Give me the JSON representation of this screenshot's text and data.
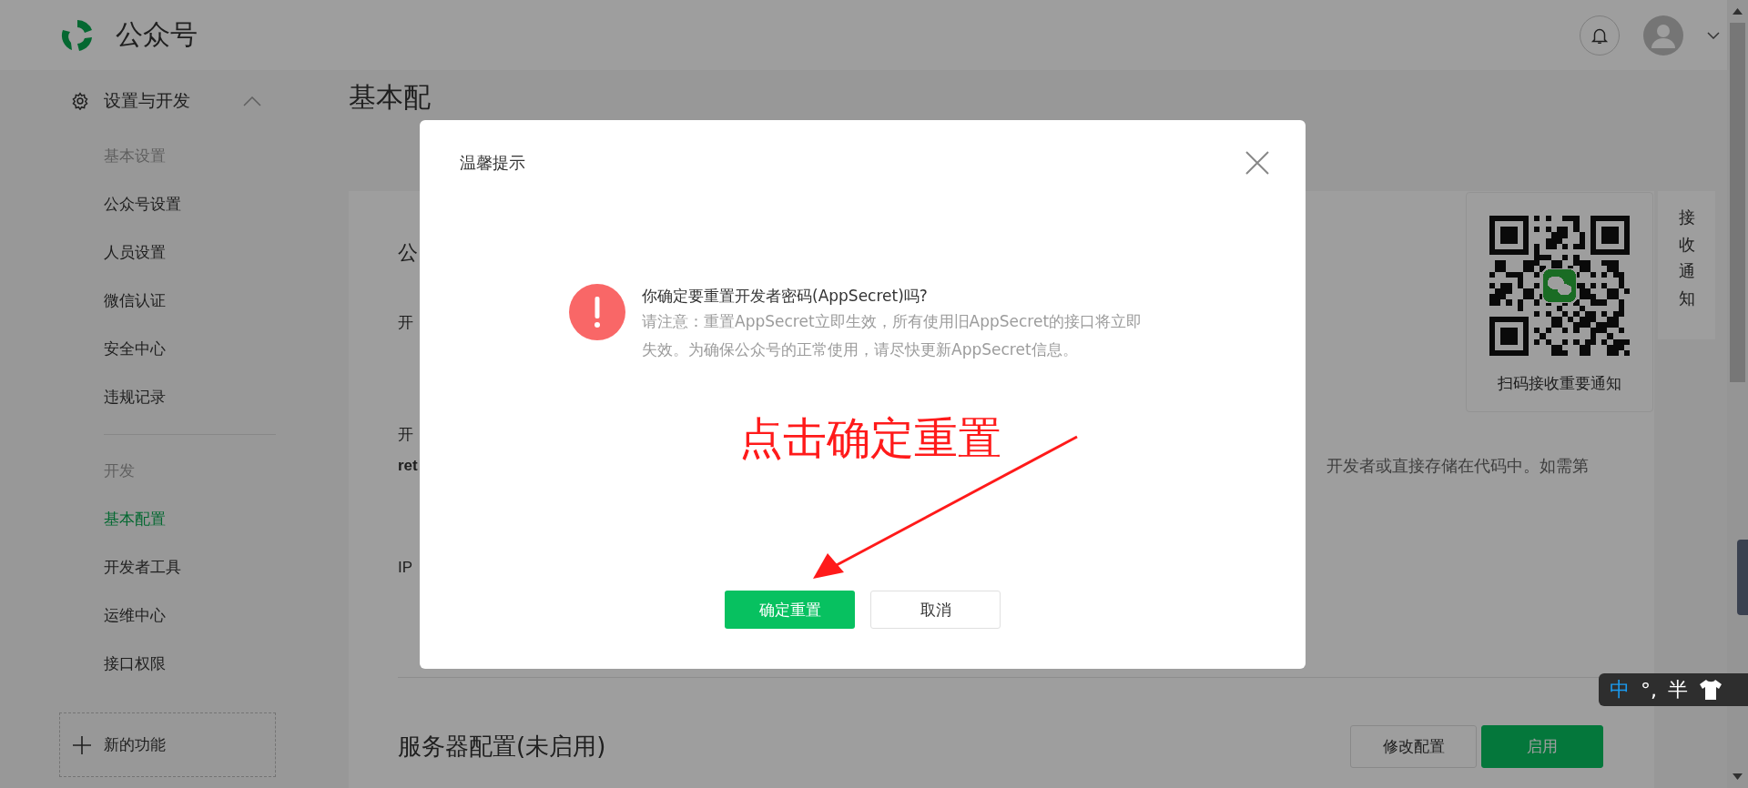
{
  "header": {
    "logo_text": "公众号"
  },
  "sidebar": {
    "section": {
      "label": "设置与开发",
      "expanded": true
    },
    "groups": [
      {
        "label": "基本设置",
        "items": [
          {
            "label": "公众号设置",
            "selected": false
          },
          {
            "label": "人员设置",
            "selected": false
          },
          {
            "label": "微信认证",
            "selected": false
          },
          {
            "label": "安全中心",
            "selected": false
          },
          {
            "label": "违规记录",
            "selected": false
          }
        ]
      },
      {
        "label": "开发",
        "items": [
          {
            "label": "基本配置",
            "selected": true
          },
          {
            "label": "开发者工具",
            "selected": false
          },
          {
            "label": "运维中心",
            "selected": false
          },
          {
            "label": "接口权限",
            "selected": false
          }
        ]
      }
    ],
    "new_feature": "新的功能"
  },
  "page": {
    "title": "基本配",
    "fragments": [
      {
        "text": "公",
        "kind": "heading"
      },
      {
        "text": "开",
        "kind": "label"
      },
      {
        "text": "开",
        "kind": "label"
      },
      {
        "text": "ret",
        "kind": "strong"
      },
      {
        "text": "IP",
        "kind": "label"
      }
    ],
    "right_text": "开发者或直接存储在代码中。如需第",
    "server_section": {
      "title": "服务器配置(未启用)",
      "buttons": [
        {
          "label": "修改配置",
          "kind": "secondary"
        },
        {
          "label": "启用",
          "kind": "primary"
        }
      ]
    }
  },
  "qr_panel": {
    "caption": "扫码接收重要通知"
  },
  "side_tab": {
    "label": "接收通知"
  },
  "dialog": {
    "title": "温馨提示",
    "heading": "你确定要重置开发者密码(AppSecret)吗?",
    "note": "请注意：重置AppSecret立即生效，所有使用旧AppSecret的接口将立即失效。为确保公众号的正常使用，请尽快更新AppSecret信息。",
    "buttons": [
      {
        "label": "确定重置",
        "kind": "primary"
      },
      {
        "label": "取消",
        "kind": "secondary"
      }
    ]
  },
  "annotation": {
    "text": "点击确定重置"
  },
  "ime_toolbar": {
    "items": [
      {
        "text": "中",
        "kind": "mode"
      },
      {
        "text": "°,",
        "kind": "plain"
      },
      {
        "text": "半",
        "kind": "plain"
      }
    ]
  }
}
